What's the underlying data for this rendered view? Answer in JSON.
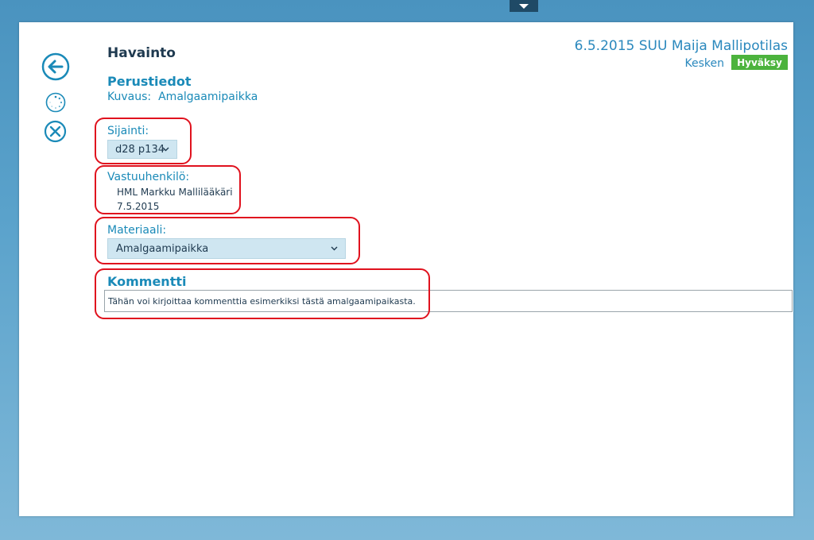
{
  "header": {
    "title": "Havainto",
    "patient_line": "6.5.2015 SUU Maija Mallipotilas",
    "status": "Kesken",
    "approve_label": "Hyväksy"
  },
  "toolbar": {
    "back_icon": "arrow-left-circle-icon",
    "loading_icon": "spinner-icon",
    "close_icon": "close-circle-icon"
  },
  "basic_info": {
    "heading": "Perustiedot",
    "description_label": "Kuvaus:",
    "description_value": "Amalgaamipaikka"
  },
  "location": {
    "label": "Sijainti:",
    "value": "d28 p134"
  },
  "responsible": {
    "label": "Vastuuhenkilö:",
    "name": "HML Markku Mallilääkäri",
    "date": "7.5.2015"
  },
  "material": {
    "label": "Materiaali:",
    "value": "Amalgaamipaikka"
  },
  "comment": {
    "heading": "Kommentti",
    "value": "Tähän voi kirjoittaa kommenttia esimerkiksi tästä amalgaamipaikasta."
  },
  "colors": {
    "accent": "#1a8ab8",
    "approve": "#4cb33d",
    "highlight": "#e0121e"
  }
}
